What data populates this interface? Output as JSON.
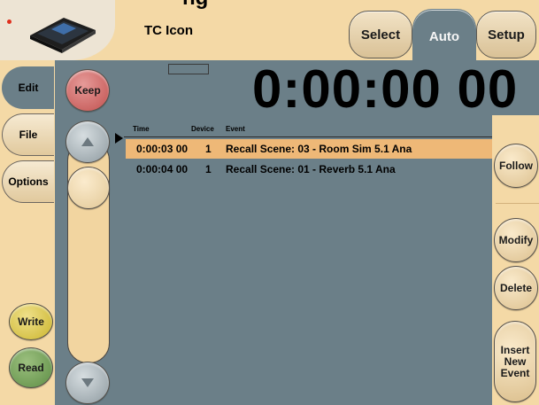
{
  "header": {
    "cropped_title": "ng",
    "app_title": "TC Icon",
    "tabs": [
      {
        "label": "Select"
      },
      {
        "label": "Auto"
      },
      {
        "label": "Setup"
      }
    ]
  },
  "left_nav": {
    "tabs": [
      {
        "label": "Edit"
      },
      {
        "label": "File"
      },
      {
        "label": "Options"
      }
    ],
    "write_label": "Write",
    "read_label": "Read"
  },
  "scroll": {
    "keep_label": "Keep"
  },
  "timecode": "0:00:00 00",
  "event_list": {
    "columns": [
      "Time",
      "Device",
      "Event"
    ],
    "rows": [
      {
        "time": "0:00:03 00",
        "device": "1",
        "event": "Recall Scene:  03 - Room Sim 5.1 Ana"
      },
      {
        "time": "0:00:04 00",
        "device": "1",
        "event": "Recall Scene:  01 - Reverb 5.1 Ana"
      }
    ]
  },
  "right_actions": {
    "follow_label": "Follow",
    "modify_label": "Modify",
    "delete_label": "Delete",
    "insert_label": "Insert New Event"
  },
  "colors": {
    "panel": "#6b7f88",
    "cream": "#f4d9a6",
    "selected_row": "#eeb877",
    "keep_red": "#c95a58",
    "write_yellow": "#d6c23c",
    "read_green": "#6a9b4e"
  }
}
